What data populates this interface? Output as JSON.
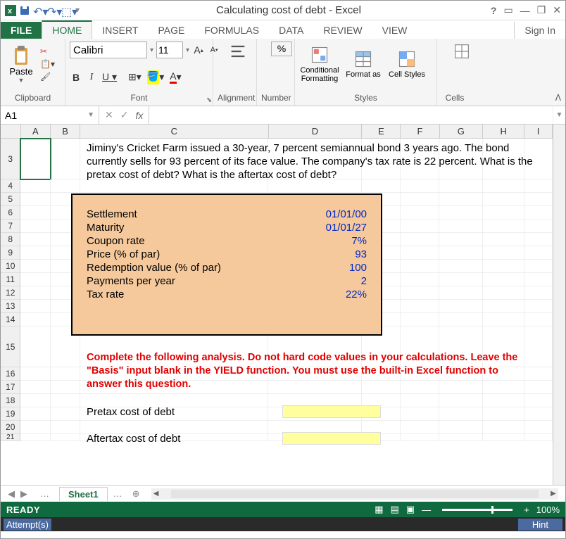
{
  "title_bar": {
    "title": "Calculating cost of debt - Excel",
    "qat": [
      "save",
      "undo",
      "redo",
      "touch"
    ]
  },
  "window_controls": {
    "help": "?",
    "ribbon_opts": "▭",
    "min": "—",
    "restore": "❐",
    "close": "✕"
  },
  "ribbon_tabs": {
    "file": "FILE",
    "tabs": [
      "HOME",
      "INSERT",
      "PAGE",
      "FORMULAS",
      "DATA",
      "REVIEW",
      "VIEW"
    ],
    "active": "HOME",
    "sign_in": "Sign In"
  },
  "ribbon": {
    "clipboard": {
      "paste": "Paste",
      "label": "Clipboard"
    },
    "font": {
      "name": "Calibri",
      "size": "11",
      "label": "Font"
    },
    "alignment": {
      "label": "Alignment"
    },
    "number": {
      "btn": "%",
      "label": "Number"
    },
    "styles": {
      "cond": "Conditional Formatting",
      "fmt": "Format as",
      "cell": "Cell Styles",
      "label": "Styles"
    },
    "cells": {
      "label": "Cells"
    }
  },
  "formula_bar": {
    "name_box": "A1",
    "fx": "fx",
    "formula": ""
  },
  "columns": [
    "A",
    "B",
    "C",
    "D",
    "E",
    "F",
    "G",
    "H",
    "I"
  ],
  "visible_rows": [
    "3",
    "4",
    "5",
    "6",
    "7",
    "8",
    "9",
    "10",
    "11",
    "12",
    "13",
    "14",
    "15",
    "16",
    "17",
    "18",
    "19",
    "20",
    "21"
  ],
  "problem": "Jiminy's Cricket Farm issued a 30-year, 7 percent semiannual bond 3 years ago. The bond currently sells for 93 percent of its face value. The company's tax rate is 22 percent. What is the pretax cost of debt? What is the aftertax cost of debt?",
  "inputs": {
    "rows": [
      {
        "label": "Settlement",
        "value": "01/01/00"
      },
      {
        "label": "Maturity",
        "value": "01/01/27"
      },
      {
        "label": "Coupon rate",
        "value": "7%"
      },
      {
        "label": "Price (% of par)",
        "value": "93"
      },
      {
        "label": "Redemption value (% of par)",
        "value": "100"
      },
      {
        "label": "Payments per year",
        "value": "2"
      },
      {
        "label": "Tax rate",
        "value": "22%"
      }
    ]
  },
  "instruction": "Complete the following analysis. Do not hard code values in your calculations. Leave the \"Basis\" input blank in the YIELD function. You must use the built-in Excel function to answer this question.",
  "answers": {
    "pretax": "Pretax cost of debt",
    "aftertax": "Aftertax cost of debt"
  },
  "sheet_tabs": {
    "active": "Sheet1"
  },
  "status": {
    "ready": "READY",
    "zoom": "100%"
  },
  "attempt": {
    "label": "Attempt(s)",
    "hint": "Hint"
  }
}
